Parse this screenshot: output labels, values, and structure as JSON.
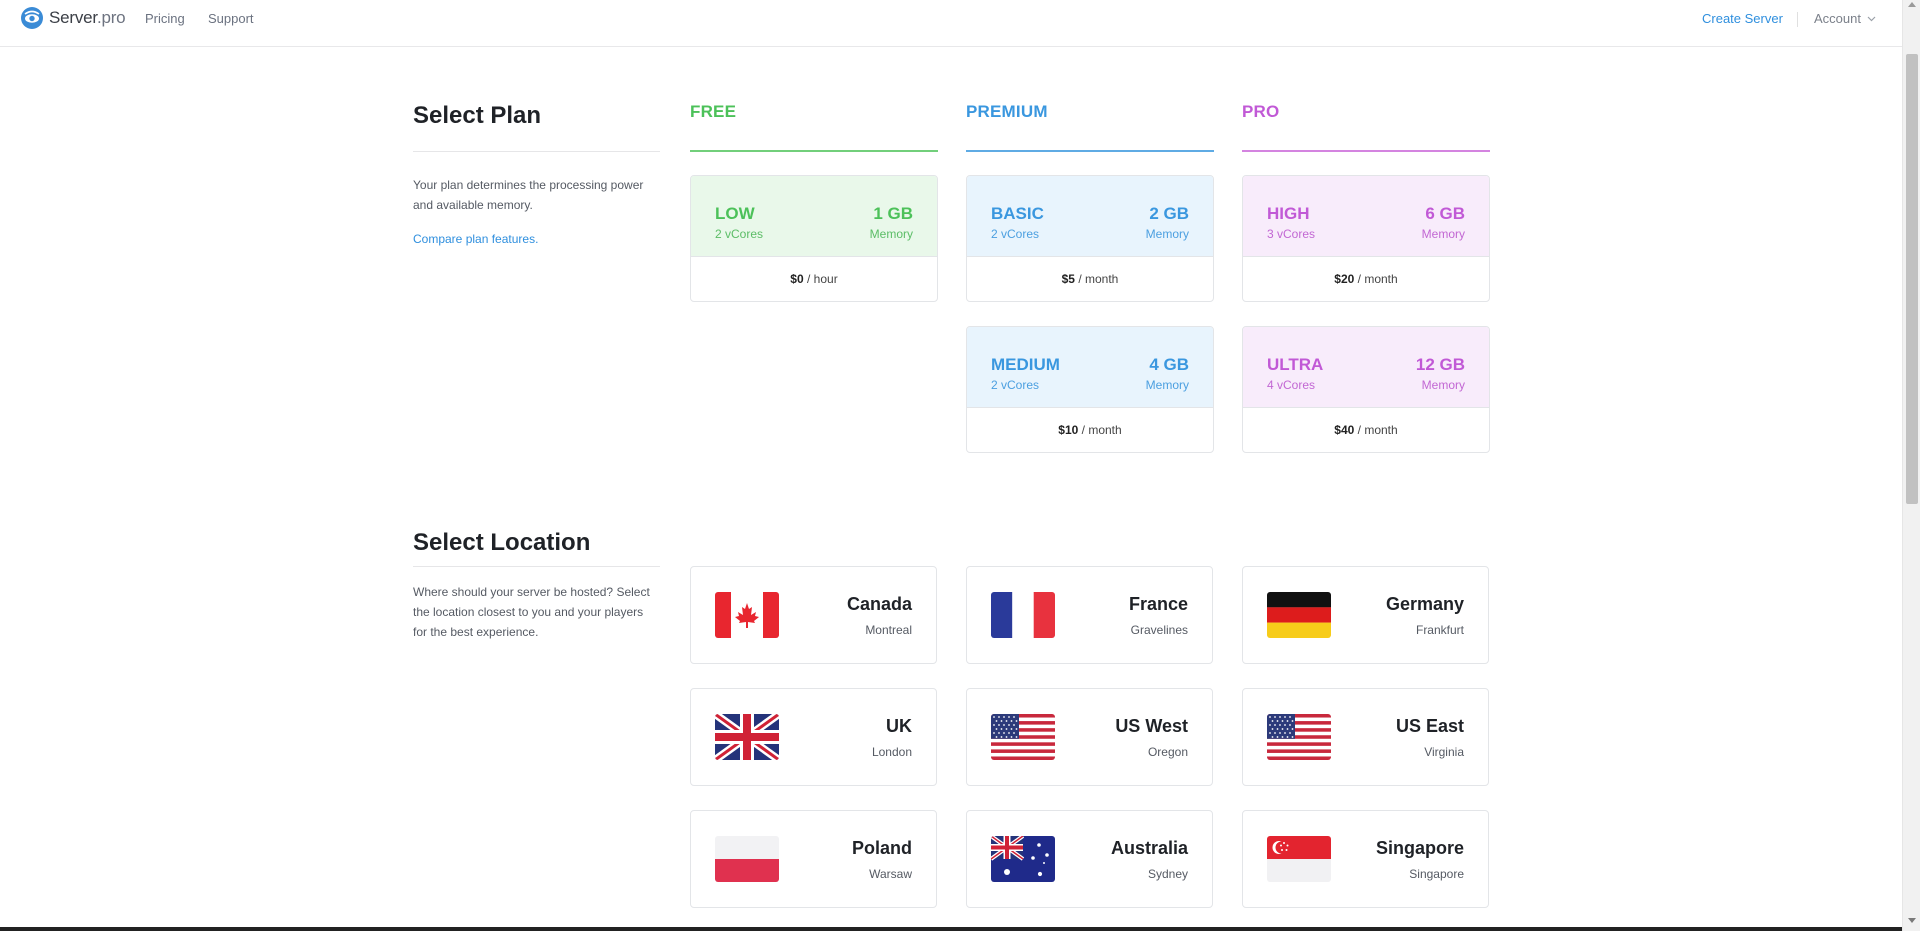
{
  "nav": {
    "brand_main": "Server",
    "brand_suffix": ".pro",
    "links": [
      "Pricing",
      "Support"
    ],
    "create_label": "Create Server",
    "account_label": "Account"
  },
  "plan_section": {
    "title": "Select Plan",
    "description": "Your plan determines the processing power and available memory.",
    "compare_link": "Compare plan features.",
    "tiers": [
      {
        "name": "FREE",
        "color": "#4cc159",
        "plans": [
          {
            "name": "LOW",
            "cores": "2 vCores",
            "memory": "1 GB",
            "memory_label": "Memory",
            "price": "$0",
            "period": "/ hour"
          }
        ]
      },
      {
        "name": "PREMIUM",
        "color": "#3a97df",
        "plans": [
          {
            "name": "BASIC",
            "cores": "2 vCores",
            "memory": "2 GB",
            "memory_label": "Memory",
            "price": "$5",
            "period": "/ month"
          },
          {
            "name": "MEDIUM",
            "cores": "2 vCores",
            "memory": "4 GB",
            "memory_label": "Memory",
            "price": "$10",
            "period": "/ month"
          }
        ]
      },
      {
        "name": "PRO",
        "color": "#c159d6",
        "plans": [
          {
            "name": "HIGH",
            "cores": "3 vCores",
            "memory": "6 GB",
            "memory_label": "Memory",
            "price": "$20",
            "period": "/ month"
          },
          {
            "name": "ULTRA",
            "cores": "4 vCores",
            "memory": "12 GB",
            "memory_label": "Memory",
            "price": "$40",
            "period": "/ month"
          }
        ]
      }
    ]
  },
  "location_section": {
    "title": "Select Location",
    "description": "Where should your server be hosted? Select the location closest to you and your players for the best experience.",
    "locations": [
      {
        "country": "Canada",
        "city": "Montreal",
        "flag": "canada-flag-icon"
      },
      {
        "country": "France",
        "city": "Gravelines",
        "flag": "france-flag-icon"
      },
      {
        "country": "Germany",
        "city": "Frankfurt",
        "flag": "germany-flag-icon"
      },
      {
        "country": "UK",
        "city": "London",
        "flag": "uk-flag-icon"
      },
      {
        "country": "US West",
        "city": "Oregon",
        "flag": "usa-flag-icon"
      },
      {
        "country": "US East",
        "city": "Virginia",
        "flag": "usa-flag-icon"
      },
      {
        "country": "Poland",
        "city": "Warsaw",
        "flag": "poland-flag-icon"
      },
      {
        "country": "Australia",
        "city": "Sydney",
        "flag": "australia-flag-icon"
      },
      {
        "country": "Singapore",
        "city": "Singapore",
        "flag": "singapore-flag-icon"
      }
    ]
  }
}
